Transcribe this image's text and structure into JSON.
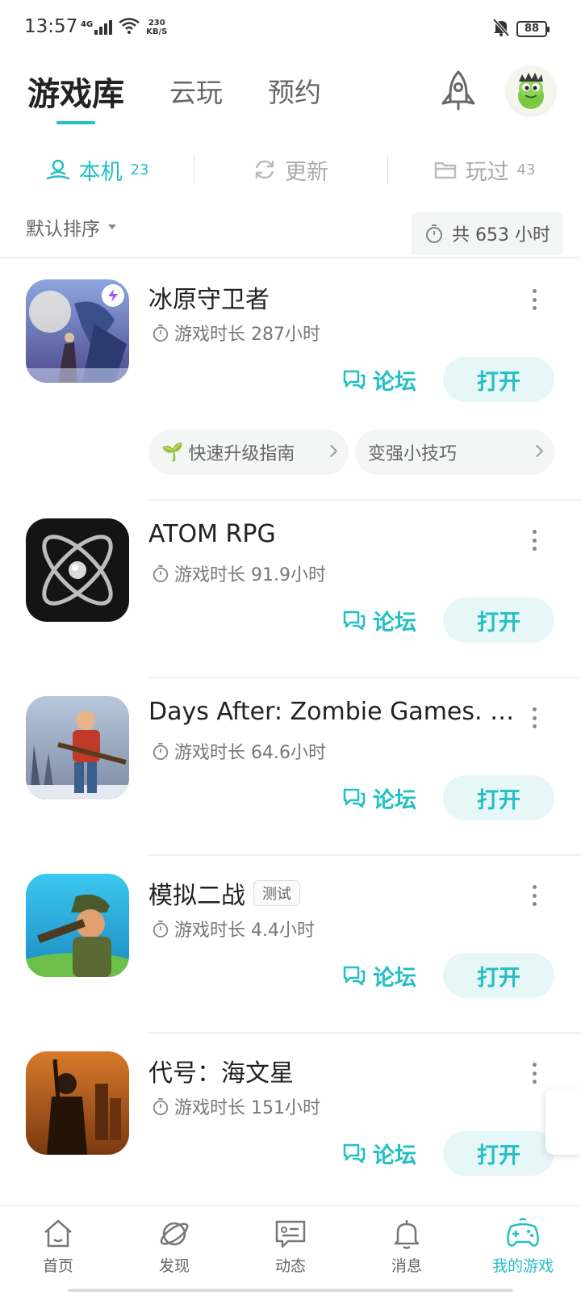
{
  "status_bar": {
    "time": "13:57",
    "network": "4G",
    "net_speed_value": "230",
    "net_speed_unit": "KB/S",
    "battery": "88"
  },
  "top_tabs": [
    {
      "label": "游戏库",
      "active": true
    },
    {
      "label": "云玩",
      "active": false
    },
    {
      "label": "预约",
      "active": false
    }
  ],
  "sub_tabs": [
    {
      "label": "本机",
      "count": "23",
      "icon": "user-device-icon",
      "active": true
    },
    {
      "label": "更新",
      "count": "",
      "icon": "refresh-icon",
      "active": false
    },
    {
      "label": "玩过",
      "count": "43",
      "icon": "folder-icon",
      "active": false
    }
  ],
  "sort": {
    "label": "默认排序",
    "total_time": "共 653 小时"
  },
  "games": [
    {
      "title": "冰原守卫者",
      "badge": "",
      "play_time": "游戏时长 287小时",
      "forum_label": "论坛",
      "open_label": "打开",
      "chips": [
        {
          "emoji": "🌱",
          "label": "快速升级指南"
        },
        {
          "emoji": "",
          "label": "变强小技巧"
        }
      ]
    },
    {
      "title": "ATOM RPG",
      "badge": "",
      "play_time": "游戏时长 91.9小时",
      "forum_label": "论坛",
      "open_label": "打开",
      "chips": []
    },
    {
      "title": "Days After: Zombie Games. Ki...",
      "badge": "",
      "play_time": "游戏时长 64.6小时",
      "forum_label": "论坛",
      "open_label": "打开",
      "chips": []
    },
    {
      "title": "模拟二战",
      "badge": "测试",
      "play_time": "游戏时长 4.4小时",
      "forum_label": "论坛",
      "open_label": "打开",
      "chips": []
    },
    {
      "title": "代号：海文星",
      "badge": "",
      "play_time": "游戏时长 151小时",
      "forum_label": "论坛",
      "open_label": "打开",
      "chips": []
    }
  ],
  "bottom_nav": [
    {
      "label": "首页",
      "icon": "home-icon",
      "active": false
    },
    {
      "label": "发现",
      "icon": "planet-icon",
      "active": false
    },
    {
      "label": "动态",
      "icon": "message-card-icon",
      "active": false
    },
    {
      "label": "消息",
      "icon": "bell-icon",
      "active": false
    },
    {
      "label": "我的游戏",
      "icon": "gamepad-icon",
      "active": true
    }
  ],
  "colors": {
    "accent": "#23bfc4",
    "accent_bg": "#e7f7f7"
  }
}
